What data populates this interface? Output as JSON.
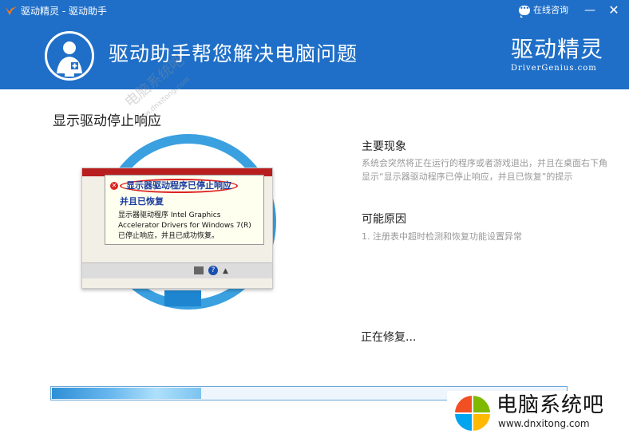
{
  "window": {
    "title": "驱动精灵 - 驱动助手",
    "chat_label": "在线咨询",
    "minimize_glyph": "—",
    "close_glyph": "✕"
  },
  "banner": {
    "title": "驱动助手帮您解决电脑问题",
    "brand_zh": "驱动精灵",
    "brand_en": "DriverGenius.com",
    "icon": "doctor-icon"
  },
  "problem": {
    "title": "显示驱动停止响应",
    "screenshot": {
      "balloon_title": "显示器驱动程序已停止响应",
      "balloon_subtitle": "并且已恢复",
      "line1": "显示器驱动程序 Intel Graphics",
      "line2": "Accelerator Drivers for Windows 7(R)",
      "line3": "已停止响应，并且已成功恢复。"
    }
  },
  "info": {
    "symptom_heading": "主要现象",
    "symptom_text": "系统会突然将正在运行的程序或者游戏退出，并且在桌面右下角显示“显示器驱动程序已停止响应，并且已恢复”的提示",
    "cause_heading": "可能原因",
    "cause_text": "1. 注册表中超时检测和恢复功能设置异常"
  },
  "status": {
    "repairing_label": "正在修复...",
    "progress_fraction": 0.29
  },
  "watermark": {
    "site_zh": "电脑系统吧",
    "site_url": "www.dnxitong.com",
    "faint_zh": "电脑系统吧",
    "faint_url": "www.dnxitong.com"
  },
  "colors": {
    "primary_blue": "#1f6fc8",
    "progress_blue": "#2e8fd6"
  }
}
